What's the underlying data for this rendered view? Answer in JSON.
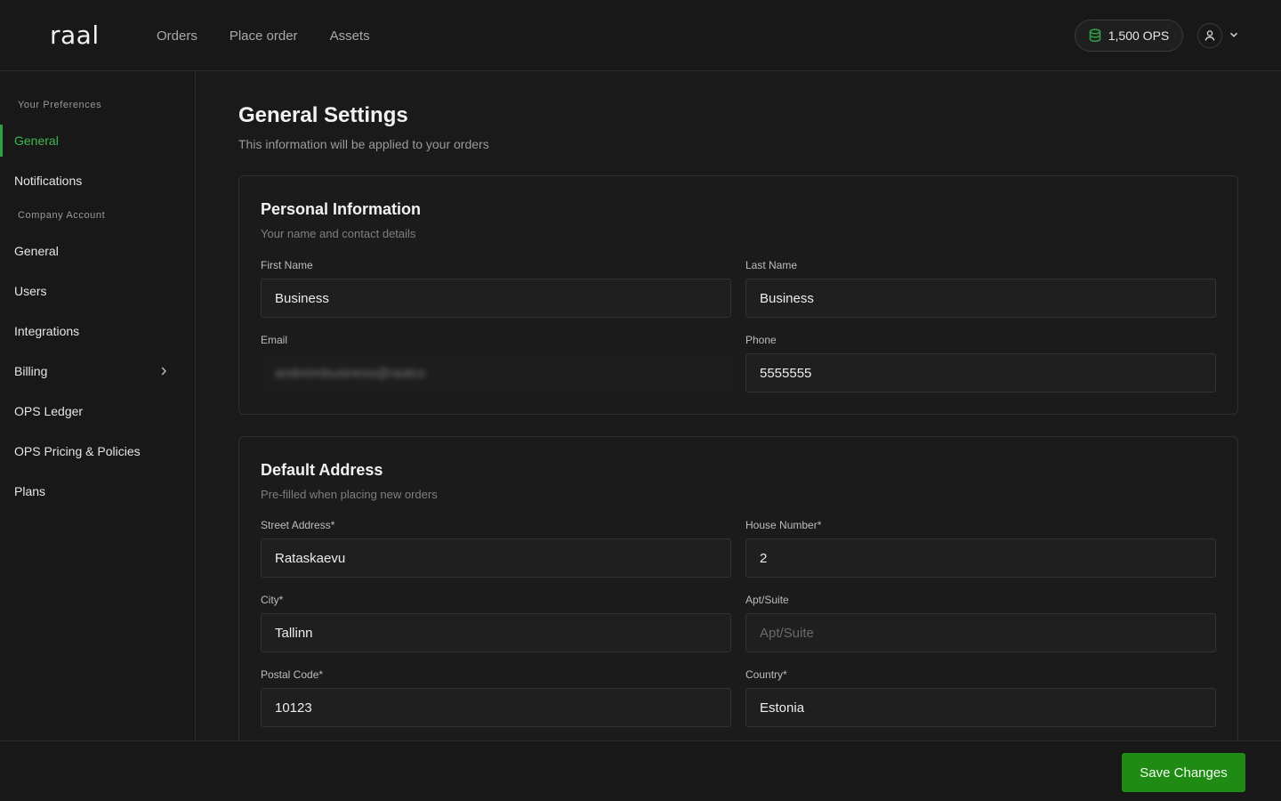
{
  "header": {
    "logo_text": "raal",
    "nav": [
      "Orders",
      "Place order",
      "Assets"
    ],
    "ops_balance": "1,500 OPS"
  },
  "sidebar": {
    "sections": [
      "Your Preferences",
      "Company Account"
    ],
    "items": [
      {
        "label": "General",
        "active": true
      },
      {
        "label": "Notifications"
      },
      {
        "label": "General"
      },
      {
        "label": "Users"
      },
      {
        "label": "Integrations"
      },
      {
        "label": "Billing"
      },
      {
        "label": "OPS Ledger"
      },
      {
        "label": "OPS Pricing & Policies"
      },
      {
        "label": "Plans"
      }
    ]
  },
  "page": {
    "title": "General Settings",
    "subtitle": "This information will be applied to your orders"
  },
  "personal": {
    "title": "Personal Information",
    "subtitle": "Your name and contact details",
    "first_name_label": "First Name",
    "first_name_value": "Business",
    "last_name_label": "Last Name",
    "last_name_value": "Business",
    "email_label": "Email",
    "email_value": "andreimbusiness@raalco",
    "phone_label": "Phone",
    "phone_value": "5555555"
  },
  "address": {
    "title": "Default Address",
    "subtitle": "Pre-filled when placing new orders",
    "street_label": "Street Address*",
    "street_value": "Rataskaevu",
    "house_label": "House Number*",
    "house_value": "2",
    "city_label": "City*",
    "city_value": "Tallinn",
    "apt_label": "Apt/Suite",
    "apt_placeholder": "Apt/Suite",
    "postal_label": "Postal Code*",
    "postal_value": "10123",
    "country_label": "Country*",
    "country_value": "Estonia"
  },
  "footer": {
    "save_label": "Save Changes"
  },
  "colors": {
    "accent": "#2ea043",
    "button": "#1f8b15",
    "background": "#1a1a1a"
  }
}
